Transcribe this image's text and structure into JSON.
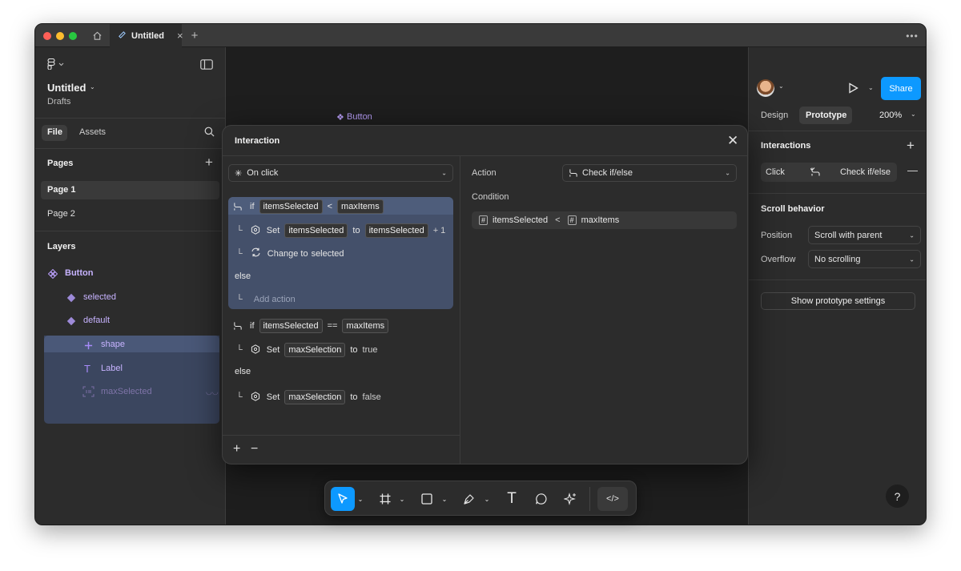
{
  "titlebar": {
    "tab_title": "Untitled"
  },
  "file": {
    "title": "Untitled",
    "location": "Drafts"
  },
  "left_tabs": {
    "file": "File",
    "assets": "Assets"
  },
  "pages": {
    "heading": "Pages",
    "items": [
      "Page 1",
      "Page 2"
    ]
  },
  "layers": {
    "heading": "Layers",
    "items": [
      {
        "name": "Button",
        "icon": "component-icon"
      },
      {
        "name": "selected",
        "icon": "variant-icon"
      },
      {
        "name": "default",
        "icon": "variant-icon"
      },
      {
        "name": "shape",
        "icon": "cross-icon"
      },
      {
        "name": "Label",
        "icon": "text-icon"
      },
      {
        "name": "maxSelected",
        "icon": "frame-icon"
      }
    ]
  },
  "canvas": {
    "component_label": "Button"
  },
  "modal": {
    "title": "Interaction",
    "trigger": "On click",
    "block1": {
      "if": "if",
      "var": "itemsSelected",
      "op": "<",
      "rhs": "maxItems",
      "set": "Set",
      "set_var": "itemsSelected",
      "to": "to",
      "set_value_var": "itemsSelected",
      "plus": "+ 1",
      "change": "Change to",
      "change_target": "selected",
      "else": "else",
      "add_action": "Add action"
    },
    "block2": {
      "if": "if",
      "var": "itemsSelected",
      "op": "==",
      "rhs": "maxItems",
      "set": "Set",
      "set_var": "maxSelection",
      "to": "to",
      "value": "true",
      "else": "else",
      "set2": "Set",
      "set_var2": "maxSelection",
      "to2": "to",
      "value2": "false"
    },
    "right": {
      "action_label": "Action",
      "action_value": "Check if/else",
      "condition_label": "Condition",
      "cond_var": "itemsSelected",
      "cond_op": "<",
      "cond_rhs": "maxItems"
    }
  },
  "right_panel": {
    "tabs": {
      "design": "Design",
      "prototype": "Prototype"
    },
    "zoom": "200%",
    "share": "Share",
    "interactions": {
      "heading": "Interactions",
      "trigger": "Click",
      "action": "Check if/else"
    },
    "scroll": {
      "heading": "Scroll behavior",
      "position_label": "Position",
      "position_value": "Scroll with parent",
      "overflow_label": "Overflow",
      "overflow_value": "No scrolling"
    },
    "show_settings": "Show prototype settings"
  },
  "help": "?",
  "colors": {
    "accent": "#0d99ff",
    "purple": "#b69cf5",
    "highlight": "#44506a"
  }
}
